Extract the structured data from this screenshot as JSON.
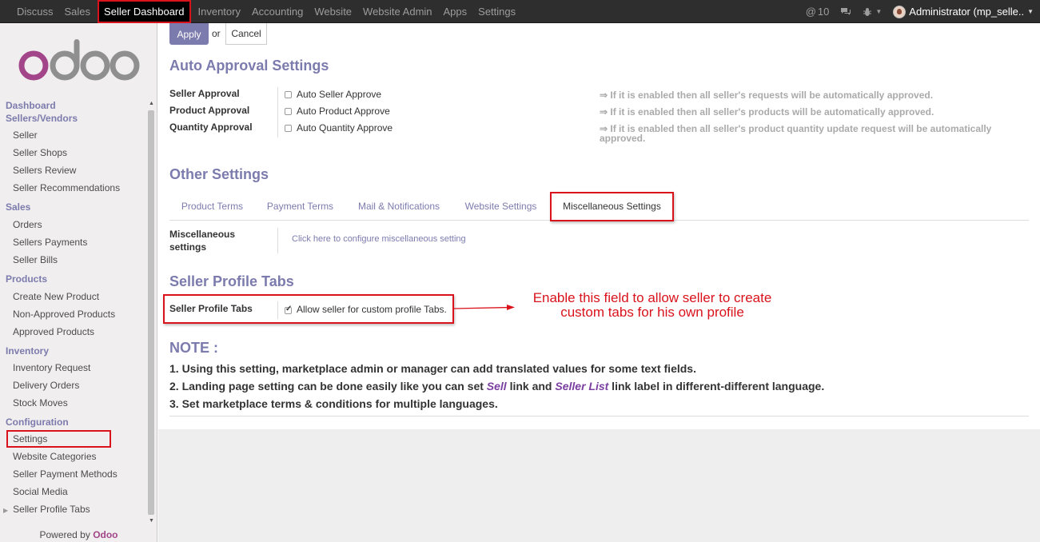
{
  "topbar": {
    "menu": [
      "Discuss",
      "Sales",
      "Seller Dashboard",
      "Inventory",
      "Accounting",
      "Website",
      "Website Admin",
      "Apps",
      "Settings"
    ],
    "active": "Seller Dashboard",
    "mentions_count": "10",
    "user": "Administrator (mp_selle.."
  },
  "sidebar": {
    "logo": "odoo",
    "sections": [
      {
        "title": "Dashboard",
        "items": []
      },
      {
        "title": "Sellers/Vendors",
        "items": [
          "Seller",
          "Seller Shops",
          "Sellers Review",
          "Seller Recommendations"
        ]
      },
      {
        "title": "Sales",
        "items": [
          "Orders",
          "Sellers Payments",
          "Seller Bills"
        ]
      },
      {
        "title": "Products",
        "items": [
          "Create New Product",
          "Non-Approved Products",
          "Approved Products"
        ]
      },
      {
        "title": "Inventory",
        "items": [
          "Inventory Request",
          "Delivery Orders",
          "Stock Moves"
        ]
      },
      {
        "title": "Configuration",
        "items": [
          "Settings",
          "Website Categories",
          "Seller Payment Methods",
          "Social Media",
          "Seller Profile Tabs"
        ]
      }
    ],
    "powered_by": "Powered by",
    "powered_brand": "Odoo"
  },
  "actions": {
    "apply": "Apply",
    "or": "or",
    "cancel": "Cancel"
  },
  "auto_approval": {
    "title": "Auto Approval Settings",
    "rows": [
      {
        "label": "Seller Approval",
        "checkbox": "Auto Seller Approve",
        "hint": "⇒ If it is enabled then all seller's requests will be automatically approved."
      },
      {
        "label": "Product Approval",
        "checkbox": "Auto Product Approve",
        "hint": "⇒ If it is enabled then all seller's products will be automatically approved."
      },
      {
        "label": "Quantity Approval",
        "checkbox": "Auto Quantity Approve",
        "hint": "⇒ If it is enabled then all seller's product quantity update request will be automatically approved."
      }
    ]
  },
  "other_settings": {
    "title": "Other Settings",
    "tabs": [
      "Product Terms",
      "Payment Terms",
      "Mail & Notifications",
      "Website Settings",
      "Miscellaneous Settings"
    ],
    "active_tab": "Miscellaneous Settings",
    "misc_label": "Miscellaneous settings",
    "misc_link": "Click here to configure miscellaneous setting"
  },
  "seller_profile": {
    "title": "Seller Profile Tabs",
    "label": "Seller Profile Tabs",
    "checkbox": "Allow seller for custom profile Tabs.",
    "checked": true,
    "annotation": "Enable this field to allow seller to create custom tabs for his own profile"
  },
  "note": {
    "title": "NOTE :",
    "line1": "1. Using this setting, marketplace admin or manager can add translated values for some text fields.",
    "line2_a": "2. Landing page setting can be done easily like you can set ",
    "line2_sell": "Sell",
    "line2_b": " link and ",
    "line2_list": "Seller List",
    "line2_c": " link label in different-different language.",
    "line3": "3. Set marketplace terms & conditions for multiple languages."
  },
  "colors": {
    "accent": "#7c7bad",
    "highlight": "#d9121b",
    "brand": "#a24689"
  }
}
